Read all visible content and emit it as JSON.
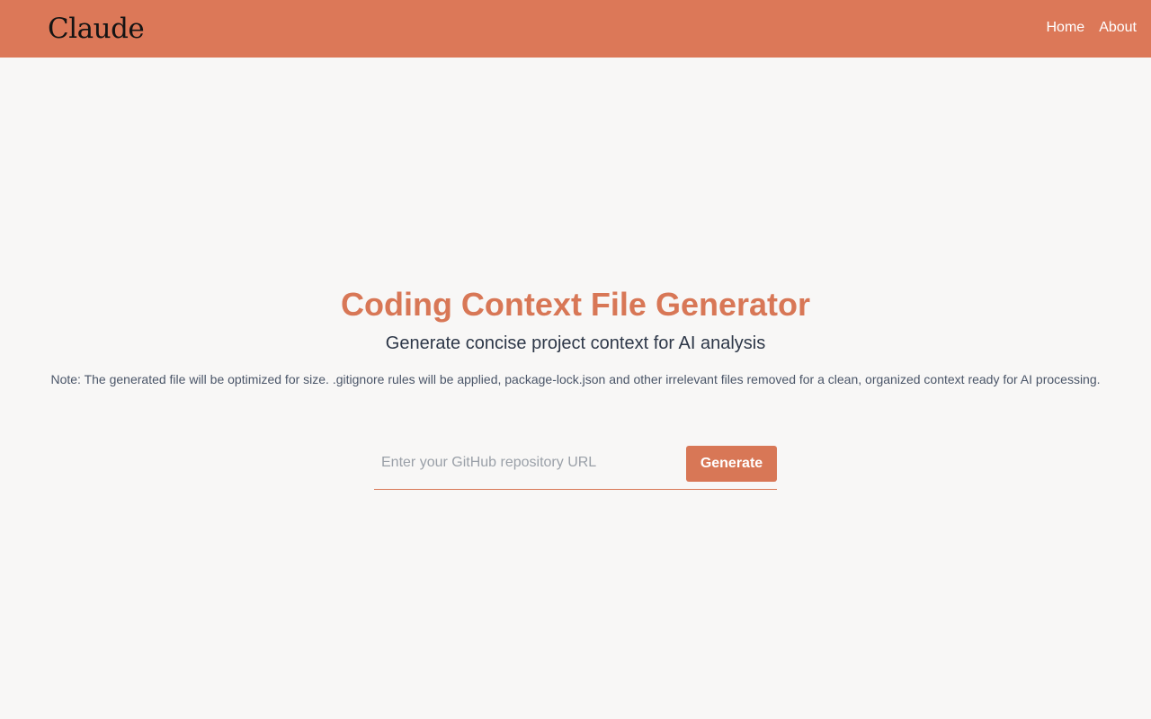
{
  "header": {
    "logo_text": "Claude",
    "nav": [
      {
        "label": "Home"
      },
      {
        "label": "About"
      }
    ]
  },
  "main": {
    "title": "Coding Context File Generator",
    "subtitle": "Generate concise project context for AI analysis",
    "note": "Note: The generated file will be optimized for size. .gitignore rules will be applied, package-lock.json and other irrelevant files removed for a clean, organized context ready for AI processing."
  },
  "form": {
    "url_placeholder": "Enter your GitHub repository URL",
    "url_value": "",
    "generate_label": "Generate"
  },
  "colors": {
    "header_bg": "#dc7858",
    "accent": "#d87756",
    "page_bg": "#f8f7f6",
    "text_dark": "#2d3748",
    "text_muted": "#4a5568"
  }
}
